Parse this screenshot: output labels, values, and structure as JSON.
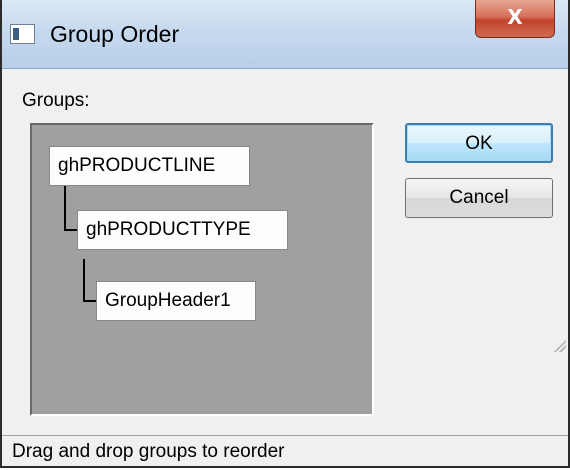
{
  "window": {
    "title": "Group Order",
    "close_glyph": "X",
    "icon": "app-window-icon"
  },
  "groups": {
    "label": "Groups:",
    "nodes": [
      {
        "label": "ghPRODUCTLINE"
      },
      {
        "label": "ghPRODUCTTYPE"
      },
      {
        "label": "GroupHeader1"
      }
    ]
  },
  "buttons": {
    "ok_label": "OK",
    "cancel_label": "Cancel"
  },
  "status": {
    "text": "Drag and drop groups to reorder"
  },
  "colors": {
    "tree_background": "#a0a0a0",
    "default_button_border": "#3c7fb1",
    "close_button": "#c0432b"
  }
}
